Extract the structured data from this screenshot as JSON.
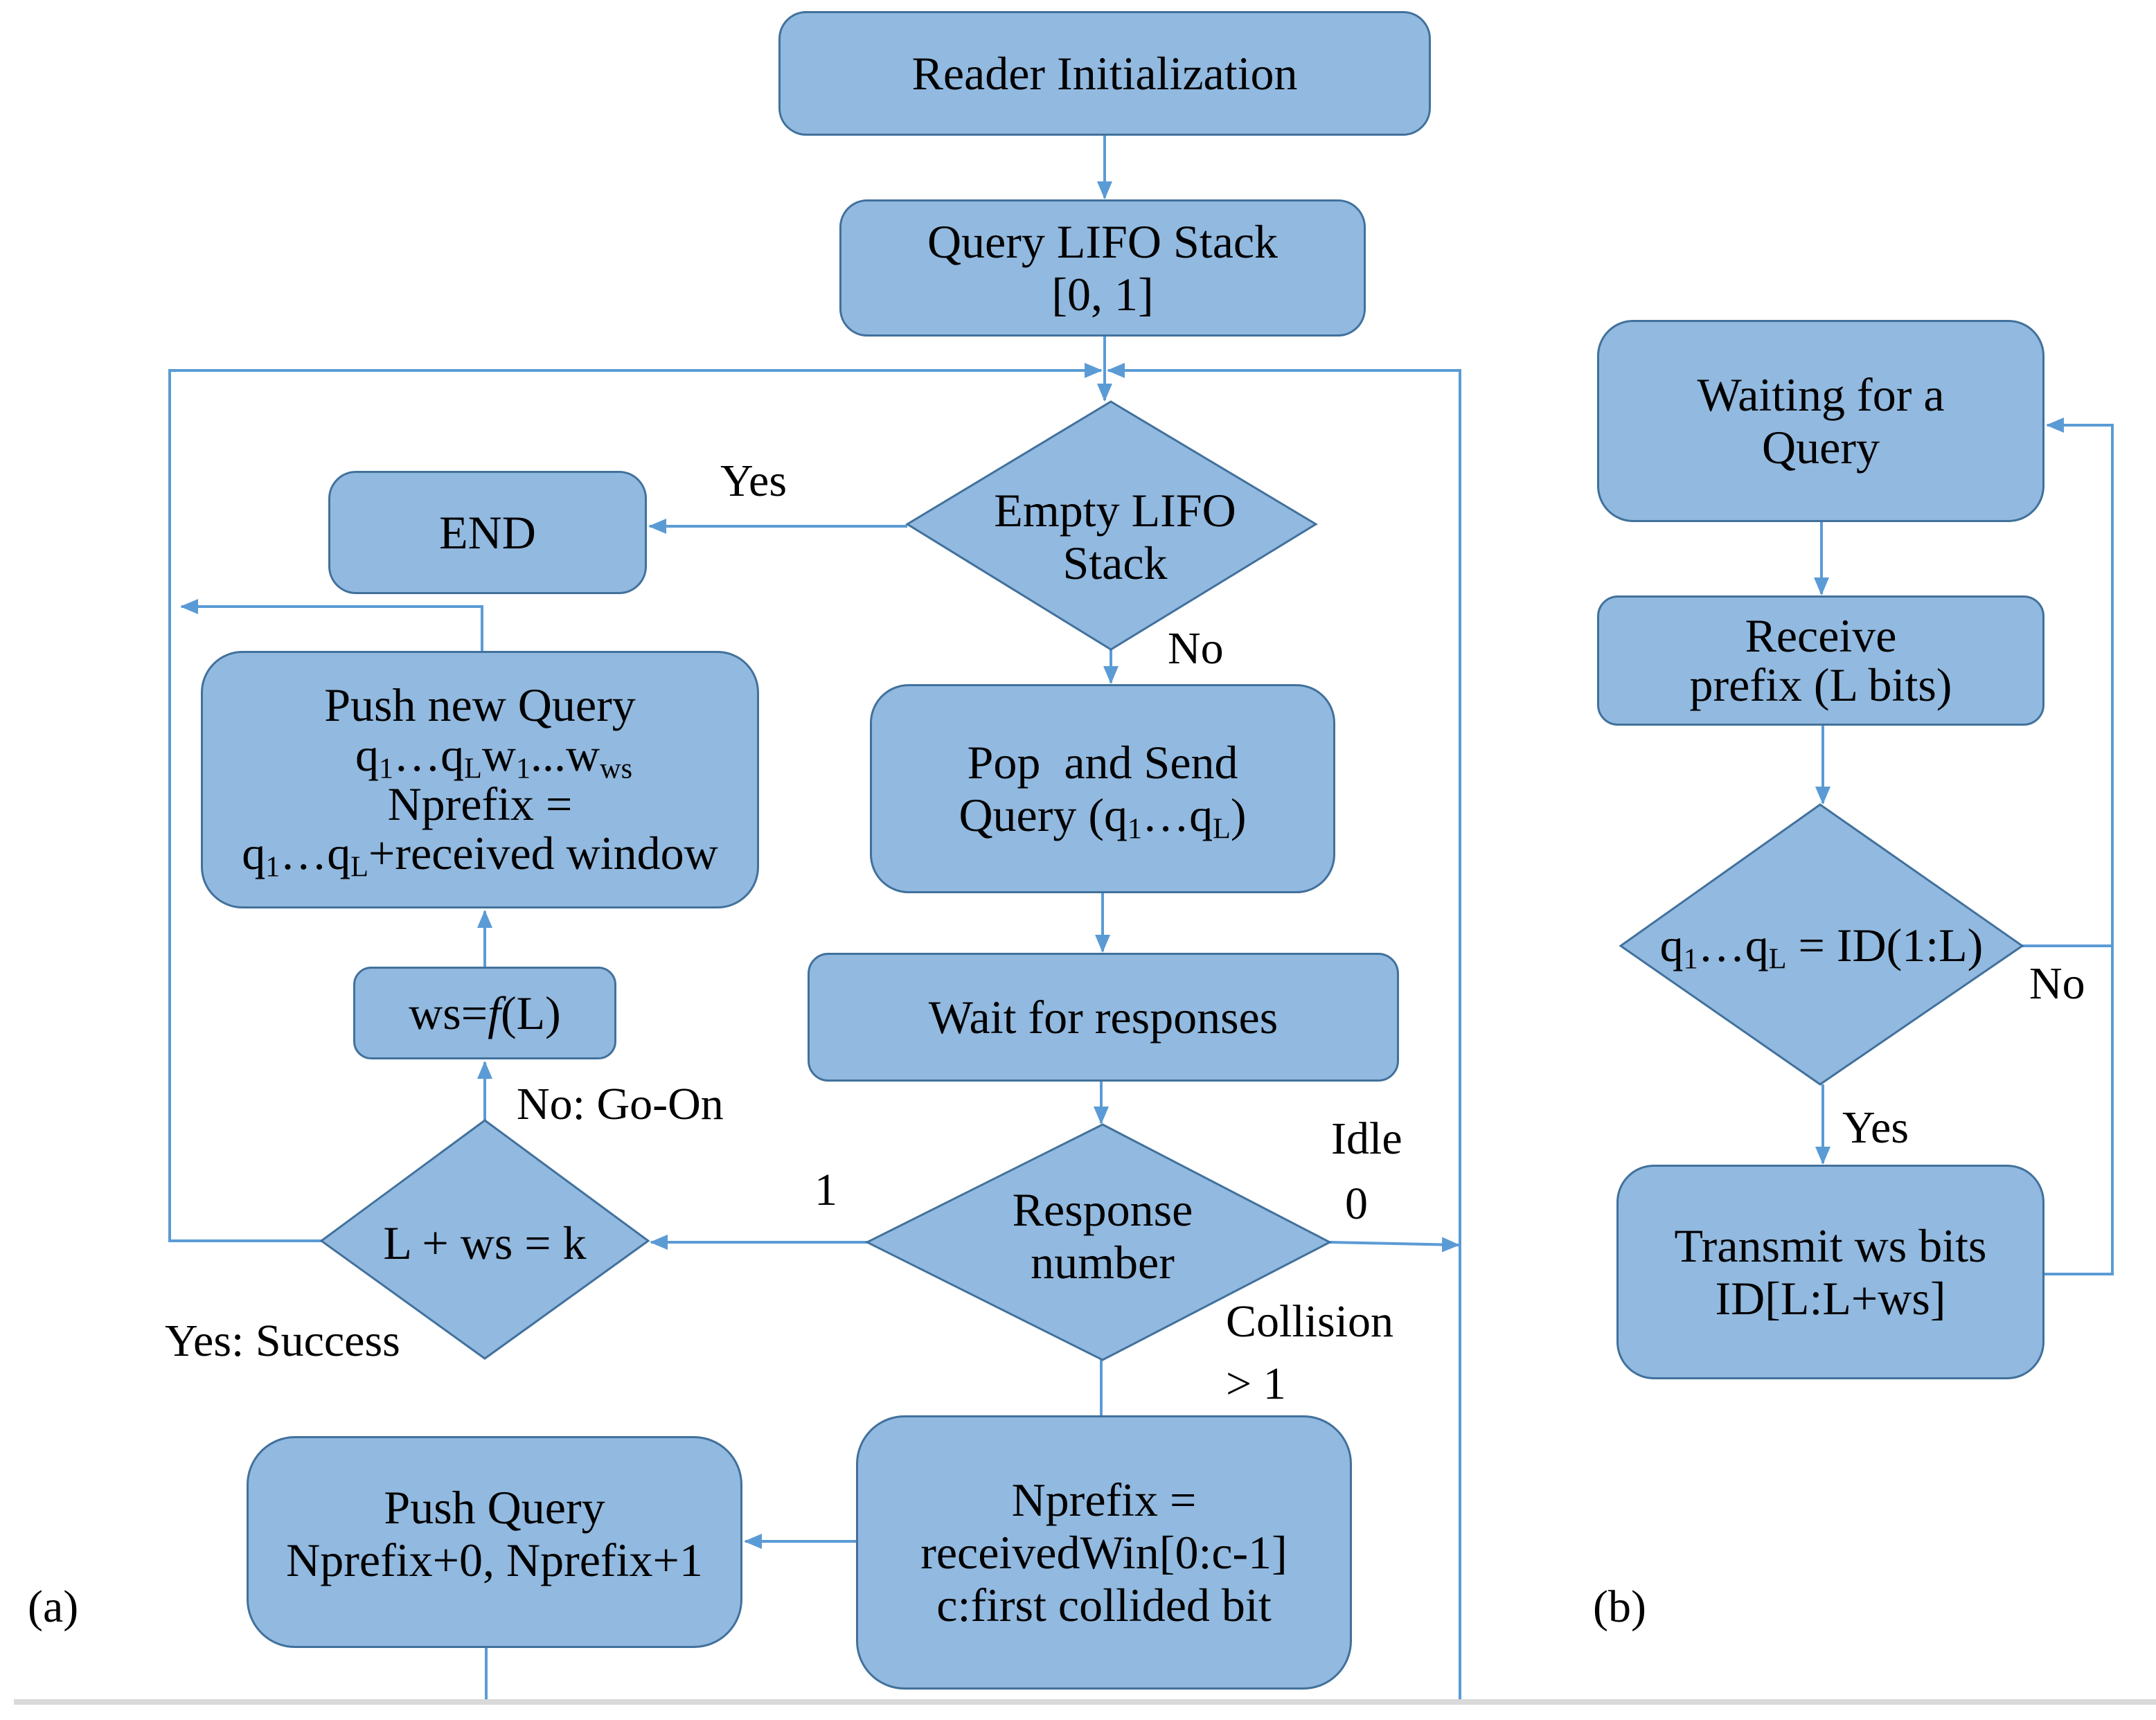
{
  "colors": {
    "box_fill": "#92b9df",
    "box_border": "#41719c",
    "connector": "#5b9bd5",
    "separator": "#d9d9d9"
  },
  "panel_a": {
    "caption": "(a)",
    "reader_init": "Reader Initialization",
    "query_stack": {
      "line1": "Query LIFO Stack",
      "line2": "[0, 1]"
    },
    "empty_stack": {
      "line1": "Empty LIFO",
      "line2": "Stack"
    },
    "end": "END",
    "push_new_query": {
      "line1": "Push new Query",
      "line2": {
        "a": "q",
        "a_sub": "1",
        "b": "…q",
        "b_sub": "L",
        "c": "w",
        "c_sub": "1",
        "d": "...w",
        "d_sub": "ws"
      },
      "line3": "Nprefix =",
      "line4": {
        "a": "q",
        "a_sub": "1",
        "b": "…q",
        "b_sub": "L",
        "c": "+received window"
      }
    },
    "ws_func": {
      "a": "ws=",
      "f": "f",
      "b": "(L)"
    },
    "l_ws_k": "L + ws = k",
    "pop_send": {
      "line1": "Pop  and Send",
      "line2": {
        "a": "Query (q",
        "a_sub": "1",
        "b": "…q",
        "b_sub": "L",
        "c": ")"
      }
    },
    "wait_responses": "Wait for responses",
    "response_number": {
      "line1": "Response",
      "line2": "number"
    },
    "nprefix_box": {
      "line1": "Nprefix =",
      "line2": "receivedWin[0:c-1]",
      "line3": "c:first collided bit"
    },
    "push_query": {
      "line1": "Push Query",
      "line2": "Nprefix+0, Nprefix+1"
    },
    "labels": {
      "yes": "Yes",
      "no": "No",
      "no_go_on": "No: Go-On",
      "yes_success": "Yes: Success",
      "one": "1",
      "idle": "Idle",
      "zero": "0",
      "collision": "Collision",
      "gt_one": "> 1"
    }
  },
  "panel_b": {
    "caption": "(b)",
    "waiting": {
      "line1": "Waiting for a",
      "line2": "Query"
    },
    "receive": {
      "line1": "Receive",
      "line2": "prefix (L bits)"
    },
    "match": {
      "a": "q",
      "a_sub": "1",
      "b": "…q",
      "b_sub": "L",
      "c": " = ID(1:L)"
    },
    "transmit": {
      "line1": "Transmit ws bits",
      "line2": "ID[L:L+ws]"
    },
    "labels": {
      "yes": "Yes",
      "no": "No"
    }
  }
}
